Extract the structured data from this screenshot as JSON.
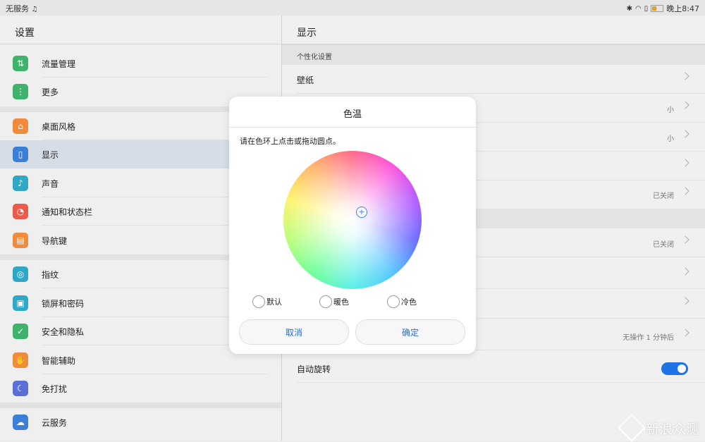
{
  "status": {
    "carrier": "无服务",
    "time": "晚上8:47"
  },
  "left": {
    "title": "设置",
    "items": [
      {
        "label": "流量管理",
        "icon": "data-usage-icon",
        "color": "#3fb36b"
      },
      {
        "label": "更多",
        "icon": "more-icon",
        "color": "#3fb36b"
      },
      {
        "label": "桌面风格",
        "icon": "home-icon",
        "color": "#f08a3c"
      },
      {
        "label": "显示",
        "icon": "display-icon",
        "color": "#3b7fd6"
      },
      {
        "label": "声音",
        "icon": "sound-icon",
        "color": "#2fa8c8"
      },
      {
        "label": "通知和状态栏",
        "icon": "bell-icon",
        "color": "#ee5a4a"
      },
      {
        "label": "导航键",
        "icon": "navigation-key-icon",
        "color": "#f08a3c"
      },
      {
        "label": "指纹",
        "icon": "fingerprint-icon",
        "color": "#2fa8c8"
      },
      {
        "label": "锁屏和密码",
        "icon": "lock-icon",
        "color": "#2fa8c8"
      },
      {
        "label": "安全和隐私",
        "icon": "shield-icon",
        "color": "#3fb36b"
      },
      {
        "label": "智能辅助",
        "icon": "hand-icon",
        "color": "#f08a3c"
      },
      {
        "label": "免打扰",
        "icon": "moon-icon",
        "color": "#5b6fd6"
      },
      {
        "label": "云服务",
        "icon": "cloud-icon",
        "color": "#3b7fd6"
      }
    ]
  },
  "right": {
    "title": "显示",
    "section1": "个性化设置",
    "wallpaper": "壁纸",
    "row_small_1": "小",
    "row_small_2": "小",
    "closed_1": "已关闭",
    "closed_2": "已关闭",
    "sleep_value": "无操作 1 分钟后",
    "auto_rotate": "自动旋转"
  },
  "dialog": {
    "title": "色温",
    "instruction": "请在色环上点击或拖动圆点。",
    "options": [
      "默认",
      "暖色",
      "冷色"
    ],
    "cancel": "取消",
    "confirm": "确定"
  },
  "watermark": "新浪众测",
  "colors": {
    "accent": "#1d74e6"
  }
}
